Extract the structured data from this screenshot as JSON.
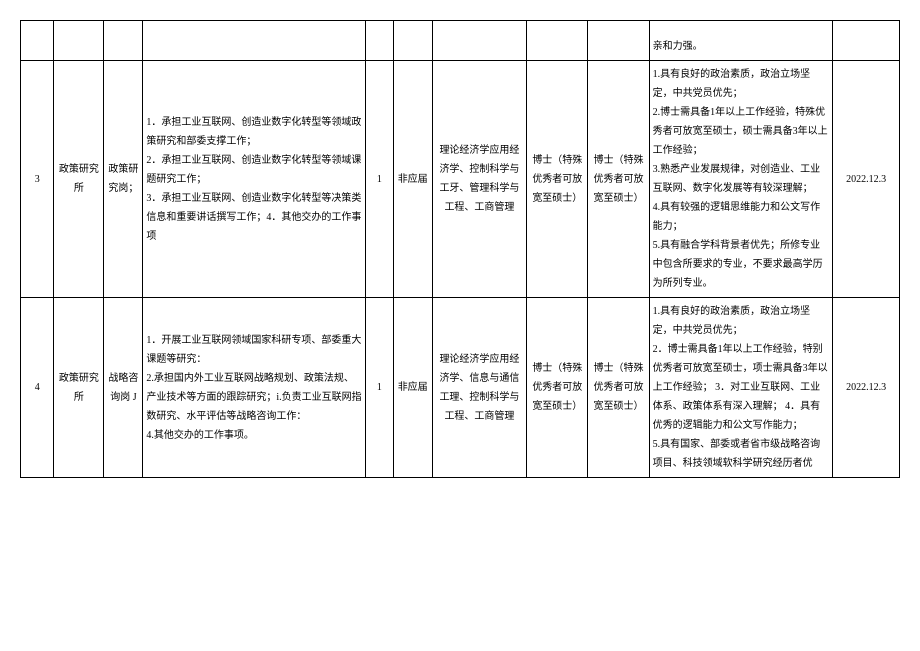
{
  "table": {
    "rows": [
      {
        "num": "",
        "dept": "",
        "post": "",
        "duty": "",
        "count": "",
        "type": "",
        "major": "",
        "edu1": "",
        "edu2": "",
        "req": "亲和力强。",
        "date": ""
      },
      {
        "num": "3",
        "dept": "政策研究所",
        "post": "政策研究岗；",
        "duty": "1．承担工业互联网、创造业数字化转型等领域政策研究和部委支撑工作；\n2．承担工业互联网、创造业数字化转型等领域课题研究工作；\n3．承担工业互联网、创造业数字化转型等决策类信息和重要讲话撰写工作；4．其他交办的工作事项",
        "count": "1",
        "type": "非应届",
        "major": "理论经济学应用经济学、控制科学与工牙、管理科学与工程、工商管理",
        "edu1": "博士（特殊优秀者可放宽至硕士）",
        "edu2": "博士（特殊优秀者可放宽至硕士）",
        "req": "1.具有良好的政治素质，政治立场坚定，中共党员优先；\n2.博士需具备1年以上工作经验，特殊优秀者可放宽至硕士，硕士需具备3年以上工作经验；\n3.熟悉产业发展规律，对创造业、工业互联网、数字化发展等有较深理解；\n4.具有较强的逻辑思维能力和公文写作能力；\n5.具有融合学科背景者优先；所修专业中包含所要求的专业，不要求最高学历为所列专业。",
        "date": "2022.12.3"
      },
      {
        "num": "4",
        "dept": "政策研究所",
        "post": "战略咨询岗 J",
        "duty": "1．开展工业互联网领域国家科研专项、部委重大课题等研究：\n2.承担国内外工业互联网战略规划、政策法规、产业技术等方面的跟踪研究；i.负责工业互联网指数研究、水平评估等战略咨询工作：\n4.其他交办的工作事项。",
        "count": "1",
        "type": "非应届",
        "major": "理论经济学应用经济学、信息与通信工理、控制科学与工程、工商管理",
        "edu1": "博士（特殊优秀者可放宽至硕士）",
        "edu2": "博士（特殊优秀者可放宽至硕士）",
        "req": "1.具有良好的政治素质，政治立场坚定，中共党员优先；\n2．博士需具备1年以上工作经验，特别优秀者可放宽至硕士，项士需具备3年以上工作经验；                                    3．对工业互联网、工业体系、政策体系有深入理解；                  4．具有优秀的逻辑能力和公文写作能力；\n5.具有国家、部委或者省市级战略咨询项目、科技领域软科学研究经历者优",
        "date": "2022.12.3"
      }
    ]
  }
}
